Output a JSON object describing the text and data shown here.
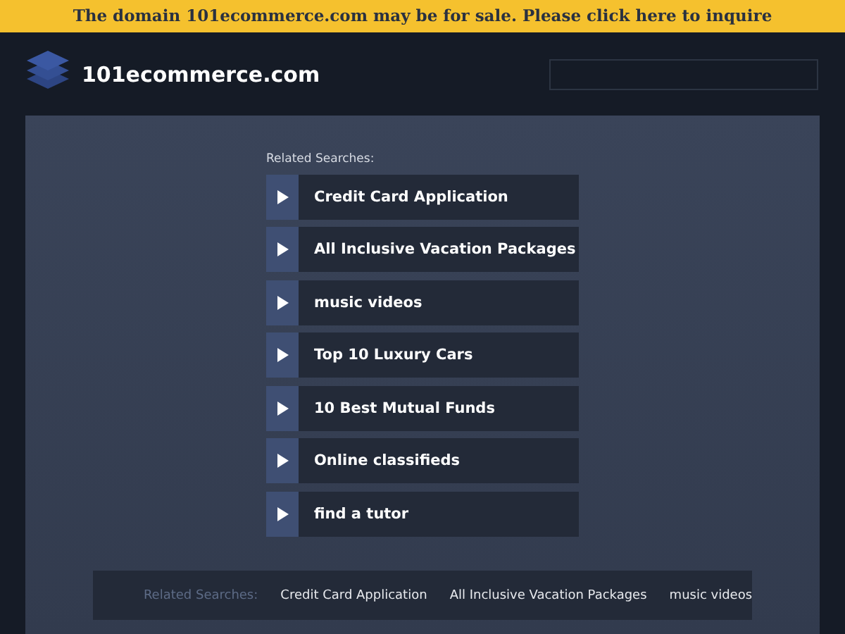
{
  "banner": {
    "text": "The domain 101ecommerce.com may be for sale. Please click here to inquire"
  },
  "header": {
    "site_name": "101ecommerce.com"
  },
  "related": {
    "label": "Related Searches:",
    "links": [
      {
        "label": "Credit Card Application"
      },
      {
        "label": "All Inclusive Vacation Packages"
      },
      {
        "label": "music videos"
      },
      {
        "label": "Top 10 Luxury Cars"
      },
      {
        "label": "10 Best Mutual Funds"
      },
      {
        "label": "Online classifieds"
      },
      {
        "label": "find a tutor"
      }
    ]
  },
  "footer": {
    "label": "Related Searches:",
    "links": [
      {
        "label": "Credit Card Application"
      },
      {
        "label": "All Inclusive Vacation Packages"
      },
      {
        "label": "music videos"
      }
    ]
  }
}
